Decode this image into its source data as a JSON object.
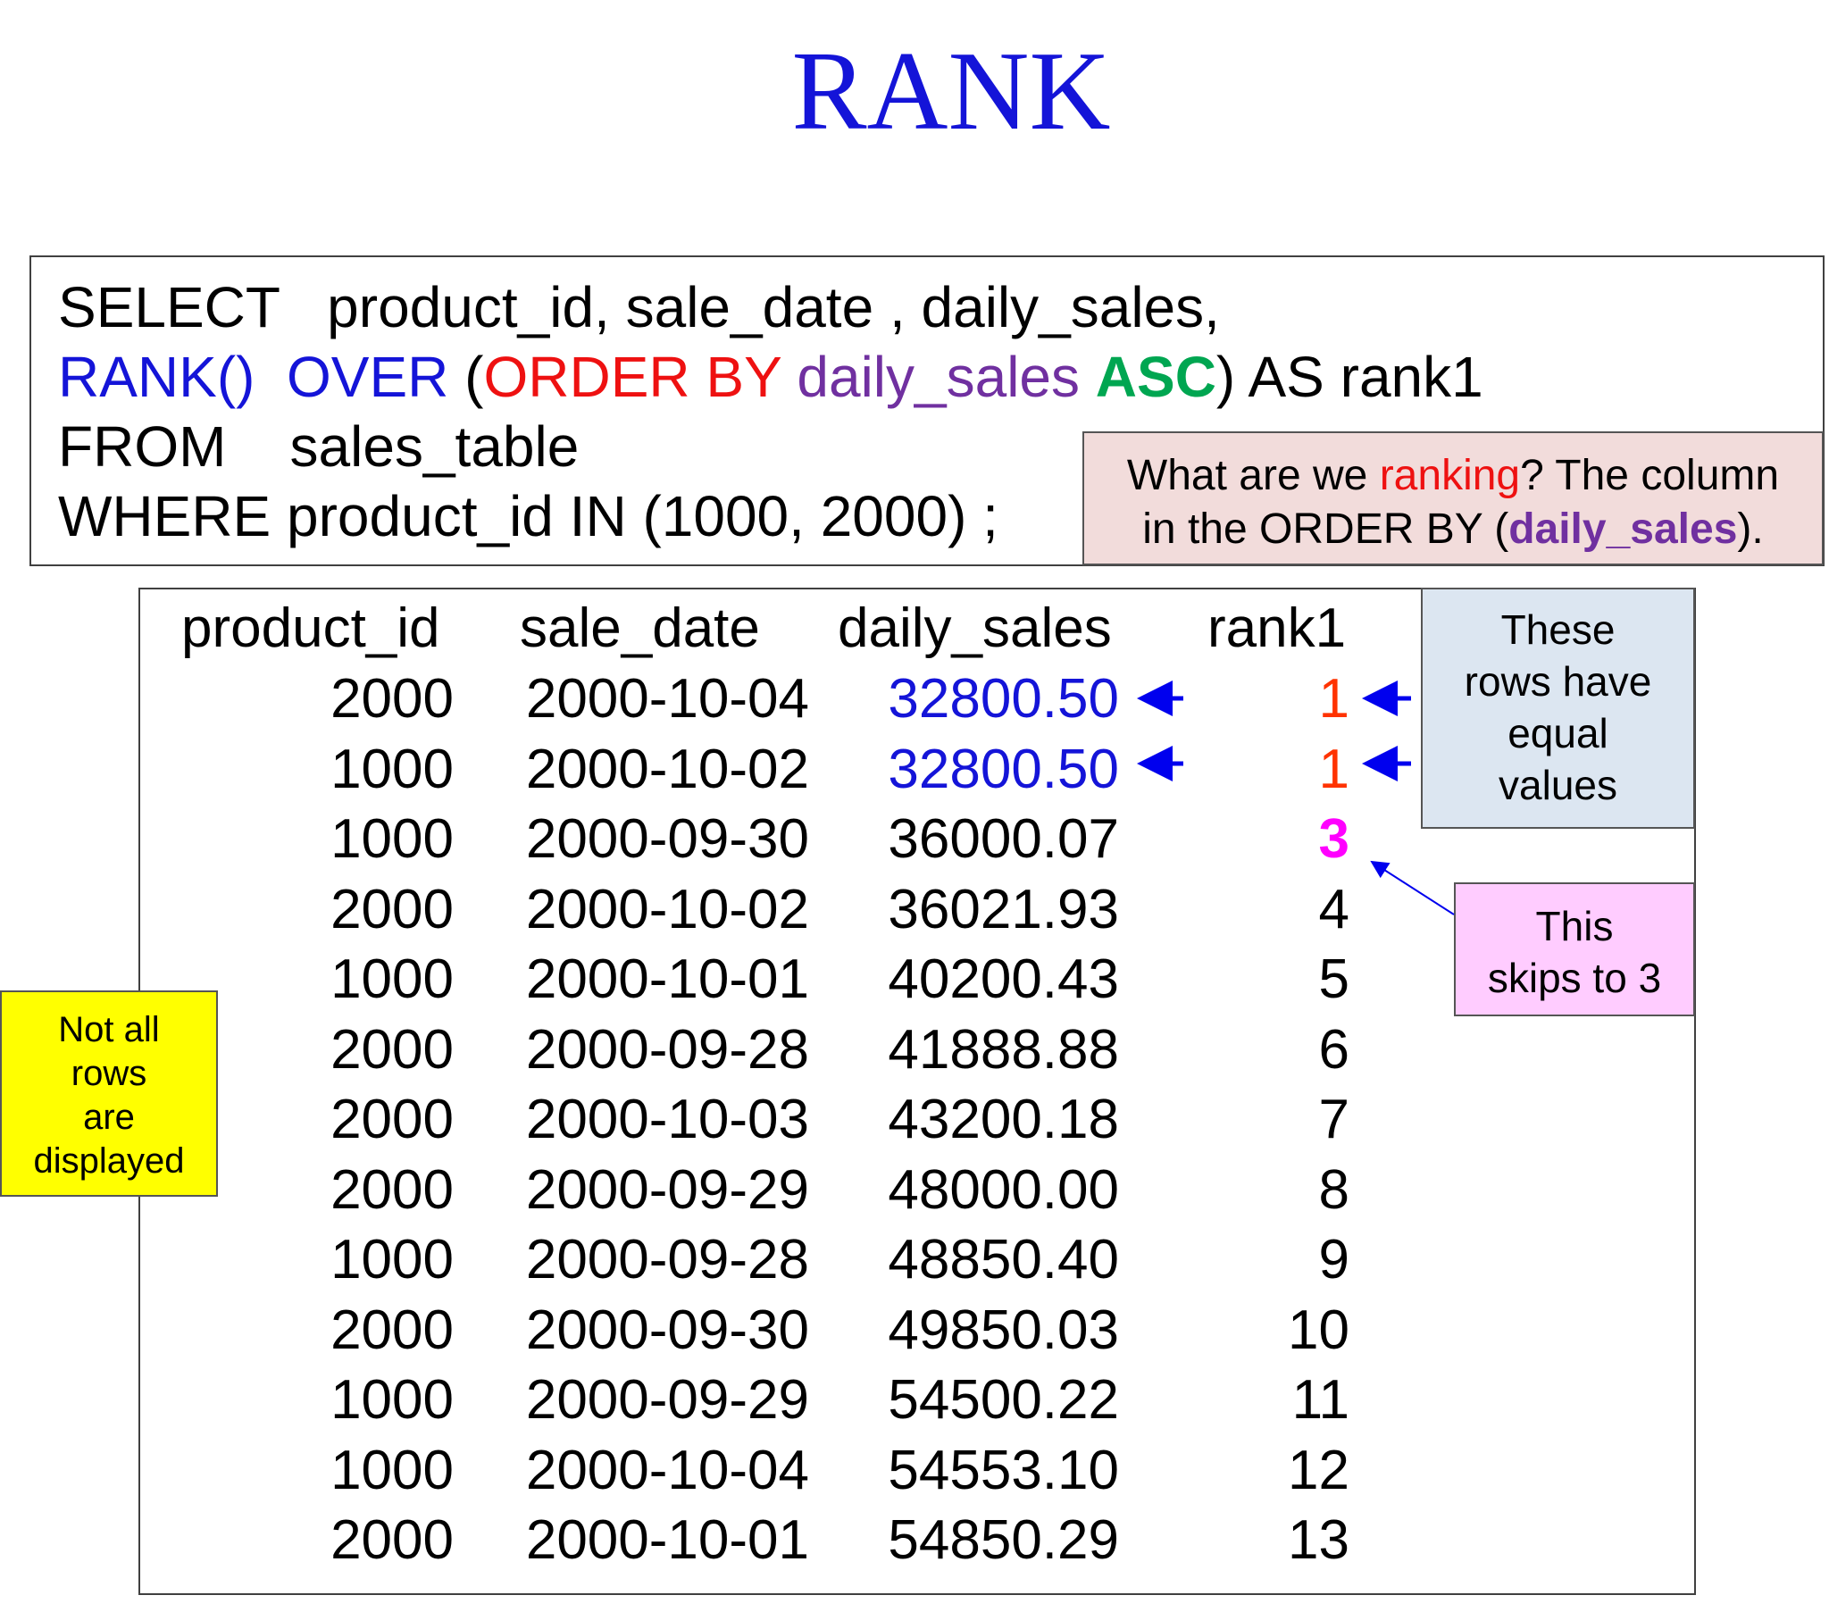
{
  "title": "RANK",
  "colors": {
    "title": "#1414d8",
    "keyword_blue": "#1414d8",
    "keyword_red": "#ee1111",
    "column_purple": "#7030a0",
    "asc_green": "#00a651",
    "tie_value_blue": "#1414d8",
    "tie_rank_orange": "#ff3300",
    "skip_rank_magenta": "#ff00ff",
    "note_order_bg": "#f2dcdb",
    "note_equal_bg": "#dce6f1",
    "note_skip_bg": "#ffccff",
    "note_rows_bg": "#ffff00"
  },
  "sql": {
    "line1": "SELECT   product_id, sale_date , daily_sales,",
    "line2": {
      "rank": "RANK()",
      "over": "OVER",
      "open_paren": " (",
      "order_by": "ORDER BY",
      "column": "daily_sales",
      "asc": "ASC",
      "tail": ") AS rank1"
    },
    "line3": "FROM    sales_table",
    "line4": "WHERE product_id IN (1000, 2000) ;"
  },
  "note_order": {
    "part1": "What are we ",
    "ranking": "ranking",
    "part2": "?  The column",
    "part3": "in the ORDER BY (",
    "column": "daily_sales",
    "part4": ")."
  },
  "table": {
    "headers": [
      "product_id",
      "sale_date",
      "daily_sales",
      "rank1"
    ],
    "rows": [
      [
        "2000",
        "2000-10-04",
        "32800.50",
        "1"
      ],
      [
        "1000",
        "2000-10-02",
        "32800.50",
        "1"
      ],
      [
        "1000",
        "2000-09-30",
        "36000.07",
        "3"
      ],
      [
        "2000",
        "2000-10-02",
        "36021.93",
        "4"
      ],
      [
        "1000",
        "2000-10-01",
        "40200.43",
        "5"
      ],
      [
        "2000",
        "2000-09-28",
        "41888.88",
        "6"
      ],
      [
        "2000",
        "2000-10-03",
        "43200.18",
        "7"
      ],
      [
        "2000",
        "2000-09-29",
        "48000.00",
        "8"
      ],
      [
        "1000",
        "2000-09-28",
        "48850.40",
        "9"
      ],
      [
        "2000",
        "2000-09-30",
        "49850.03",
        "10"
      ],
      [
        "1000",
        "2000-09-29",
        "54500.22",
        "11"
      ],
      [
        "1000",
        "2000-10-04",
        "54553.10",
        "12"
      ],
      [
        "2000",
        "2000-10-01",
        "54850.29",
        "13"
      ]
    ]
  },
  "note_equal": {
    "line1": "These",
    "line2": "rows have",
    "line3": "equal",
    "line4": "values"
  },
  "note_skip": {
    "line1": "This",
    "line2": "skips to 3"
  },
  "note_rows": {
    "line1": "Not all",
    "line2": "rows",
    "line3": "are",
    "line4": "displayed"
  }
}
